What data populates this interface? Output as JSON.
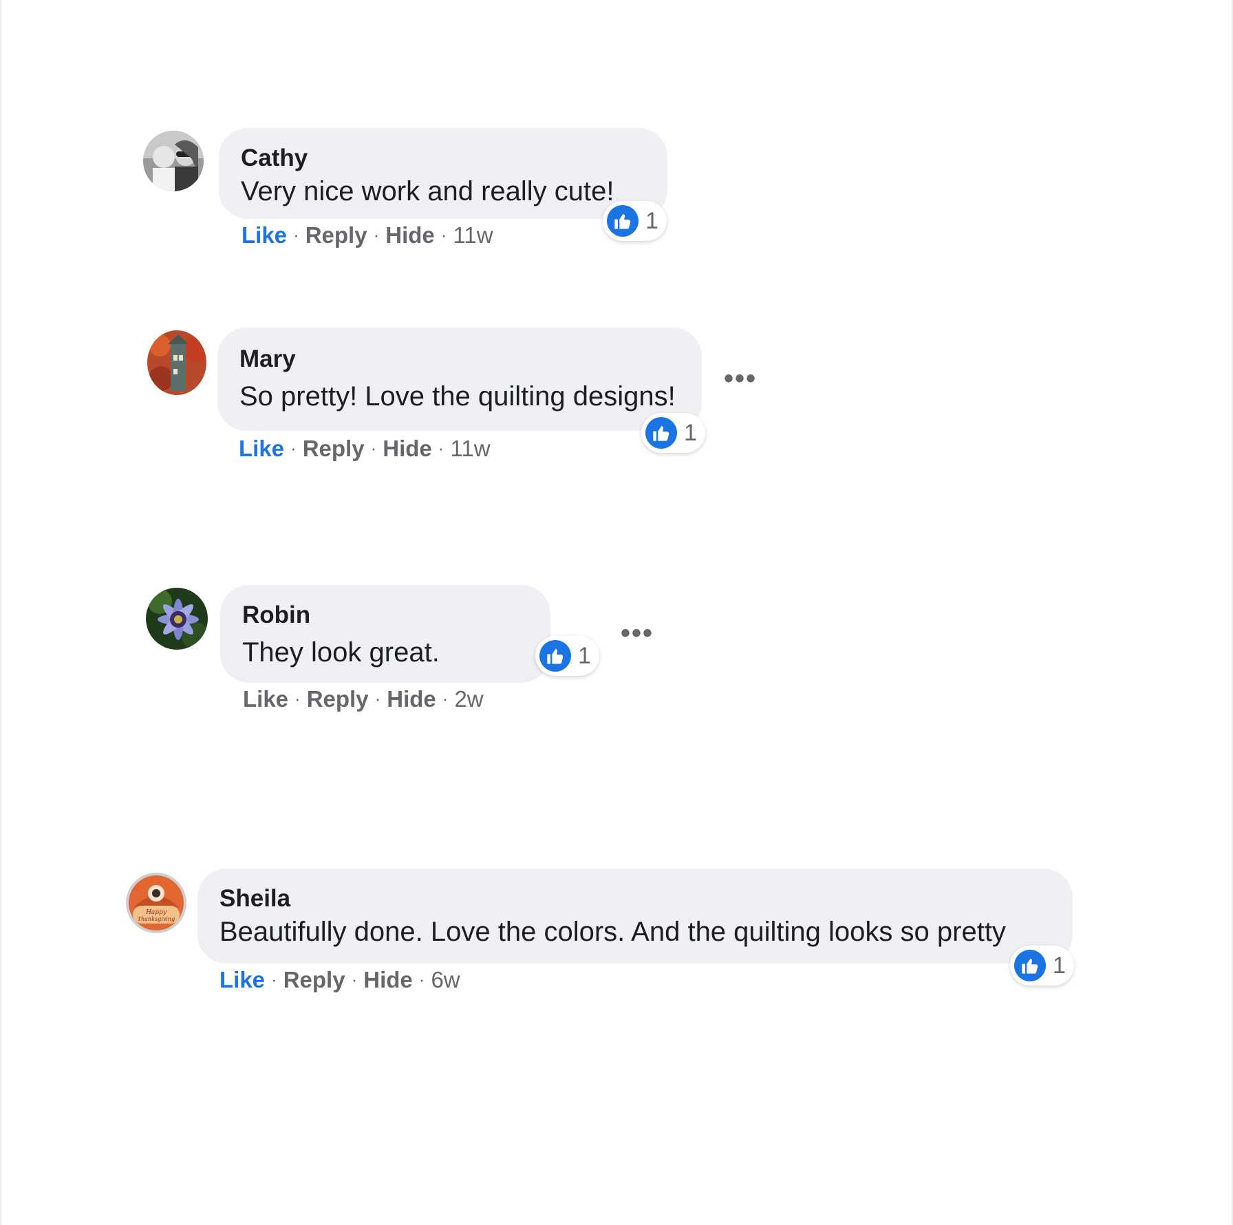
{
  "colors": {
    "bubble_bg": "#eef0f3",
    "like_blue": "#1b74e4",
    "meta_gray": "#65676b",
    "text": "#1c1e21"
  },
  "icons": {
    "like": "thumbs-up-icon",
    "more": "more-options-icon"
  },
  "comments": [
    {
      "author": "Cathy",
      "text": "Very nice work and really cute!",
      "actions": {
        "like": "Like",
        "reply": "Reply",
        "hide": "Hide"
      },
      "time": "11w",
      "liked": true,
      "reaction_count": "1",
      "more_menu": false
    },
    {
      "author": "Mary",
      "text": "So pretty! Love the quilting designs!",
      "actions": {
        "like": "Like",
        "reply": "Reply",
        "hide": "Hide"
      },
      "time": "11w",
      "liked": true,
      "reaction_count": "1",
      "more_menu": true
    },
    {
      "author": "Robin",
      "text": "They look great.",
      "actions": {
        "like": "Like",
        "reply": "Reply",
        "hide": "Hide"
      },
      "time": "2w",
      "liked": false,
      "reaction_count": "1",
      "more_menu": true
    },
    {
      "author": "Sheila",
      "text": "Beautifully done. Love the colors. And the quilting looks so pretty",
      "actions": {
        "like": "Like",
        "reply": "Reply",
        "hide": "Hide"
      },
      "time": "6w",
      "liked": true,
      "reaction_count": "1",
      "more_menu": false
    }
  ],
  "avatars": [
    {
      "name": "Cathy",
      "logo_text": ""
    },
    {
      "name": "Mary",
      "logo_text": ""
    },
    {
      "name": "Robin",
      "logo_text": ""
    },
    {
      "name": "Sheila",
      "logo_text": "Happy Thanksgiving"
    }
  ]
}
